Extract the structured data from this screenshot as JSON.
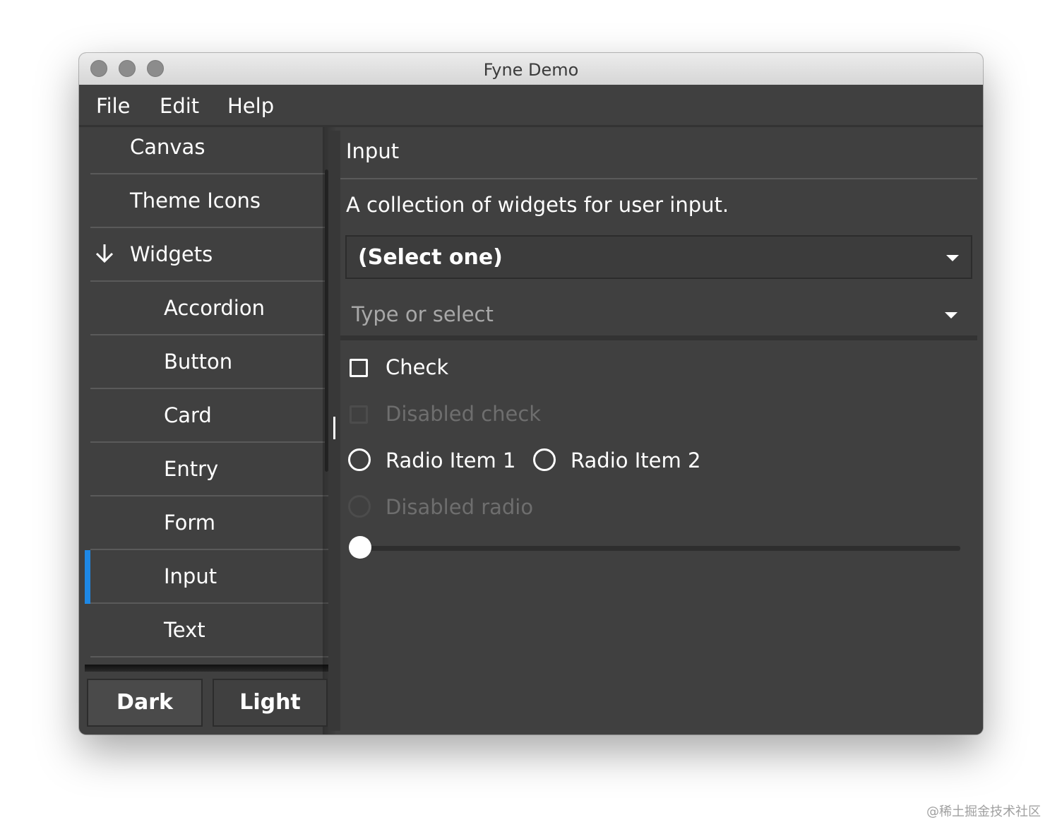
{
  "window": {
    "title": "Fyne Demo"
  },
  "menu": {
    "items": [
      "File",
      "Edit",
      "Help"
    ]
  },
  "sidebar": {
    "items": [
      {
        "label": "Canvas",
        "level": 0
      },
      {
        "label": "Theme Icons",
        "level": 0
      },
      {
        "label": "Widgets",
        "level": 0,
        "icon": "arrow-down-icon",
        "expanded": true
      },
      {
        "label": "Accordion",
        "level": 1
      },
      {
        "label": "Button",
        "level": 1
      },
      {
        "label": "Card",
        "level": 1
      },
      {
        "label": "Entry",
        "level": 1
      },
      {
        "label": "Form",
        "level": 1
      },
      {
        "label": "Input",
        "level": 1,
        "selected": true
      },
      {
        "label": "Text",
        "level": 1
      }
    ],
    "theme_buttons": {
      "dark": "Dark",
      "light": "Light"
    }
  },
  "content": {
    "title": "Input",
    "subtitle": "A collection of widgets for user input.",
    "select": {
      "value": "(Select one)"
    },
    "select_entry": {
      "placeholder": "Type or select"
    },
    "check": {
      "label": "Check",
      "checked": false
    },
    "disabled_check": {
      "label": "Disabled check"
    },
    "radios": [
      {
        "label": "Radio Item 1",
        "selected": false
      },
      {
        "label": "Radio Item 2",
        "selected": false
      }
    ],
    "disabled_radio": {
      "label": "Disabled radio"
    },
    "slider": {
      "value": 0
    }
  },
  "colors": {
    "background": "#404040",
    "accent": "#1e88e5",
    "text": "#ffffff",
    "disabled_text": "#6e6e6e"
  },
  "watermark": "@稀土掘金技术社区"
}
